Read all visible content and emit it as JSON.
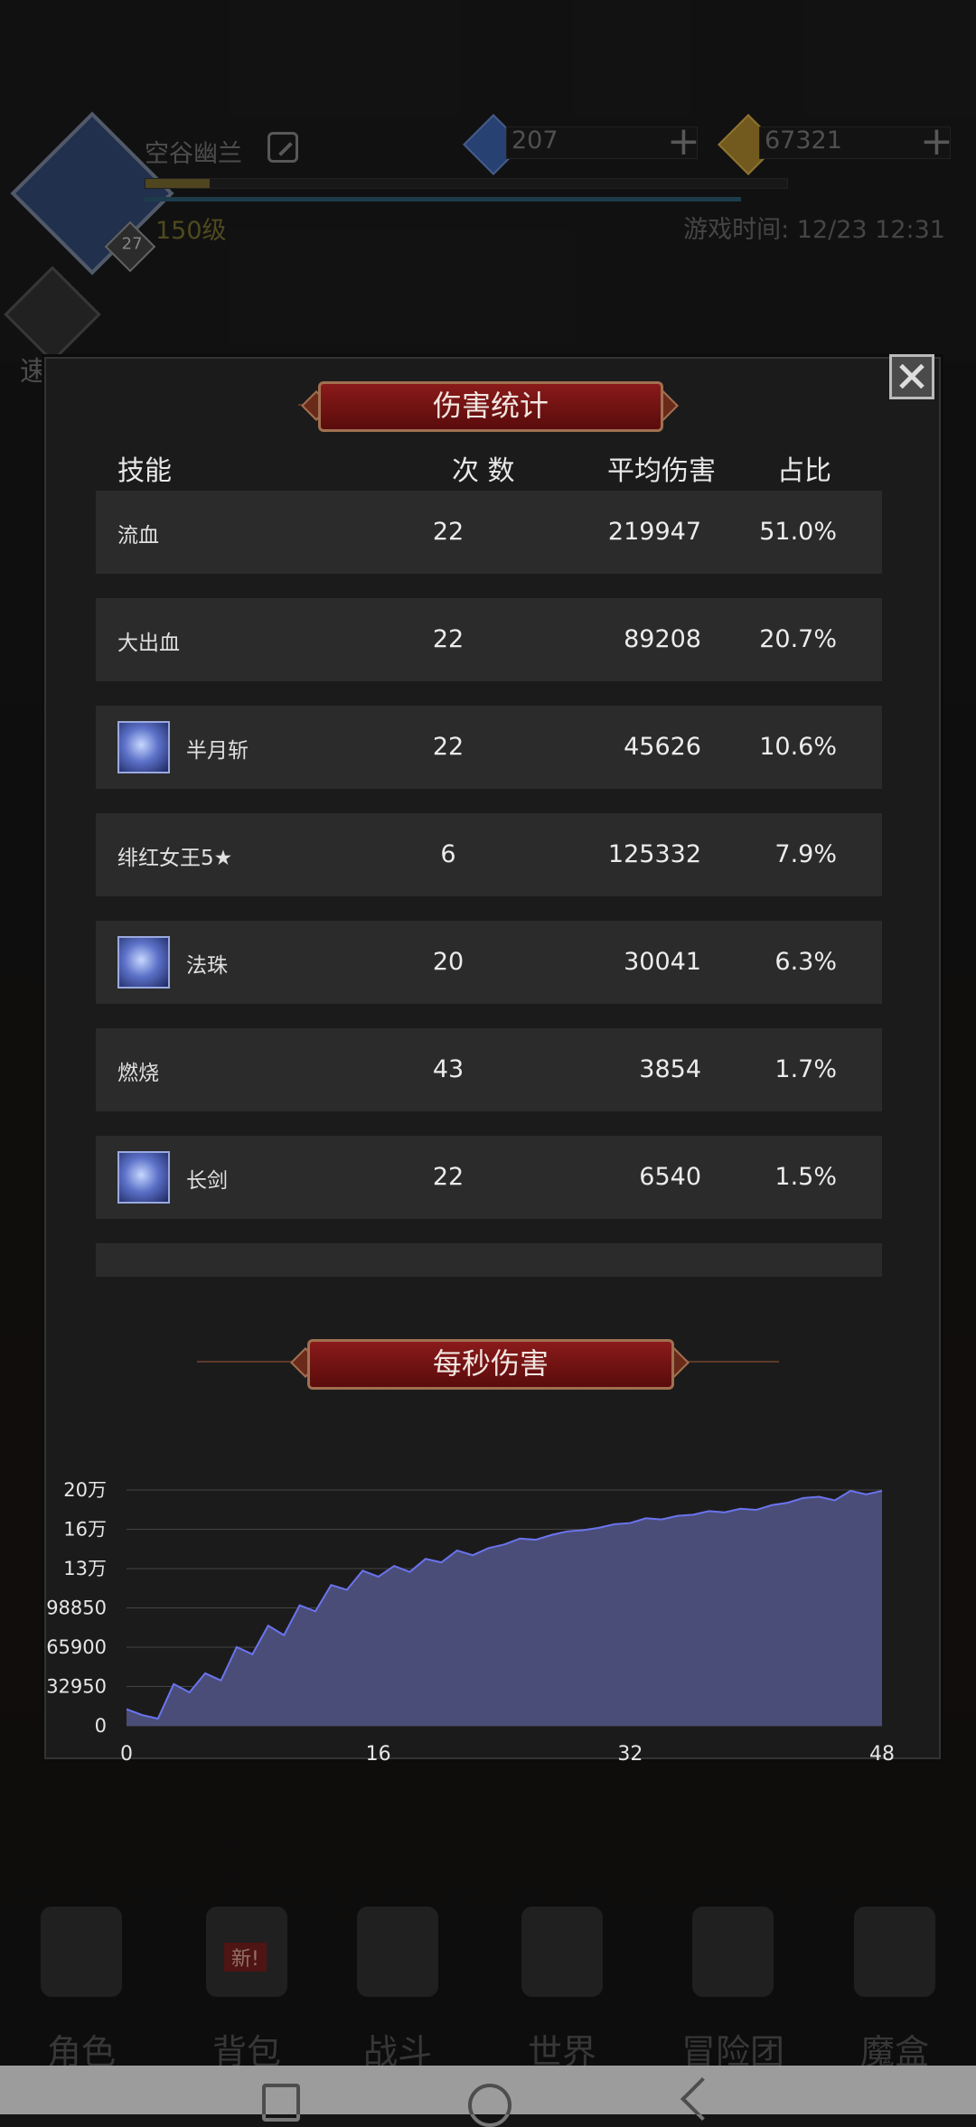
{
  "header": {
    "player_name": "空谷幽兰",
    "level": "150级",
    "avatar_level": "27",
    "xp_progress": 0.1,
    "gems": "207",
    "gold": "67321",
    "game_time": "游戏时间: 12/23 12:31",
    "speed_label": "速战"
  },
  "modal": {
    "title": "伤害统计",
    "columns": [
      "技能",
      "次 数",
      "平均伤害",
      "占比"
    ],
    "rows": [
      {
        "skill": "流血",
        "icon": "",
        "count": "22",
        "avg": "219947",
        "pct": "51.0%"
      },
      {
        "skill": "大出血",
        "icon": "",
        "count": "22",
        "avg": "89208",
        "pct": "20.7%"
      },
      {
        "skill": "半月斩",
        "icon": "crescent-moon-icon",
        "count": "22",
        "avg": "45626",
        "pct": "10.6%"
      },
      {
        "skill": "绯红女王5★",
        "icon": "",
        "count": "6",
        "avg": "125332",
        "pct": "7.9%"
      },
      {
        "skill": "法珠",
        "icon": "magic-orb-icon",
        "count": "20",
        "avg": "30041",
        "pct": "6.3%"
      },
      {
        "skill": "燃烧",
        "icon": "",
        "count": "43",
        "avg": "3854",
        "pct": "1.7%"
      },
      {
        "skill": "长剑",
        "icon": "long-sword-icon",
        "count": "22",
        "avg": "6540",
        "pct": "1.5%"
      }
    ],
    "chart_title": "每秒伤害"
  },
  "chart_data": {
    "type": "area",
    "title": "每秒伤害",
    "xlabel": "",
    "ylabel": "",
    "xlim": [
      0,
      48
    ],
    "ylim": [
      0,
      197700
    ],
    "x_ticks": [
      "0",
      "16",
      "32",
      "48"
    ],
    "y_ticks": [
      "0",
      "32950",
      "65900",
      "98850",
      "13万",
      "16万",
      "20万"
    ],
    "grid": true,
    "color": "#4a4d78",
    "line_color": "#6a74ee",
    "x": [
      0,
      1,
      2,
      3,
      4,
      5,
      6,
      7,
      8,
      9,
      10,
      11,
      12,
      13,
      14,
      15,
      16,
      17,
      18,
      19,
      20,
      21,
      22,
      23,
      24,
      25,
      26,
      27,
      28,
      29,
      30,
      31,
      32,
      33,
      34,
      35,
      36,
      37,
      38,
      39,
      40,
      41,
      42,
      43,
      44,
      45,
      46,
      47,
      48
    ],
    "y": [
      14000,
      9000,
      6000,
      35000,
      28000,
      44000,
      38000,
      66000,
      60000,
      84000,
      76000,
      101000,
      96000,
      118000,
      114000,
      130000,
      125000,
      134000,
      129000,
      140000,
      137000,
      147000,
      143000,
      149000,
      152000,
      157000,
      156000,
      160000,
      163000,
      164000,
      166000,
      169000,
      170000,
      174000,
      173000,
      176000,
      177000,
      180000,
      179000,
      182000,
      181000,
      185000,
      187000,
      191000,
      192000,
      189000,
      197000,
      194000,
      197000
    ]
  },
  "bottom_nav": {
    "items": [
      "角色",
      "背包",
      "战斗",
      "世界",
      "冒险团",
      "魔盒"
    ],
    "new_badge": "新!"
  }
}
